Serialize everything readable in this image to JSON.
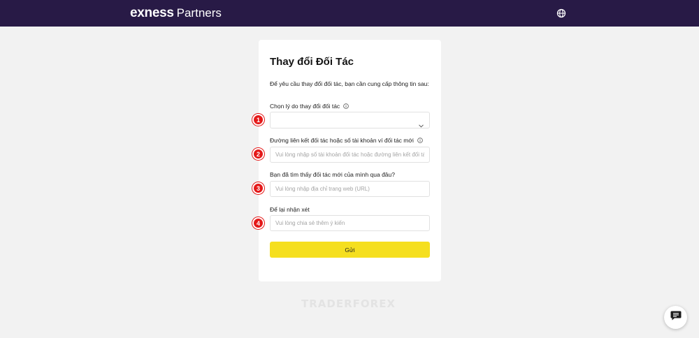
{
  "header": {
    "brand": "exness",
    "partners": "Partners",
    "language_icon": "globe-icon"
  },
  "form": {
    "title": "Thay đổi Đối Tác",
    "intro": "Để yêu cầu thay đổi đối tác, bạn cần cung cấp thông tin sau:",
    "reason_label": "Chọn lý do thay đổi đối tác",
    "reason_value": "",
    "link_label": "Đường liên kết đối tác hoặc số tài khoản ví đối tác mới",
    "link_placeholder": "Vui lòng nhập số tài khoản đối tác hoặc đường liên kết đối tác",
    "source_label": "Bạn đã tìm thấy đối tác mới của mình qua đâu?",
    "source_placeholder": "Vui lòng nhập địa chỉ trang web (URL)",
    "comment_label": "Để lại nhận xét",
    "comment_placeholder": "Vui lòng chia sẻ thêm ý kiến",
    "submit_label": "Gửi"
  },
  "markers": [
    "1",
    "2",
    "3",
    "4"
  ],
  "watermark": "TRADERFOREX",
  "chat_icon": "chat-icon",
  "colors": {
    "header_bg": "#281a46",
    "submit_bg": "#f5df1f",
    "marker": "#e41919",
    "page_bg": "#f2f2f2"
  }
}
